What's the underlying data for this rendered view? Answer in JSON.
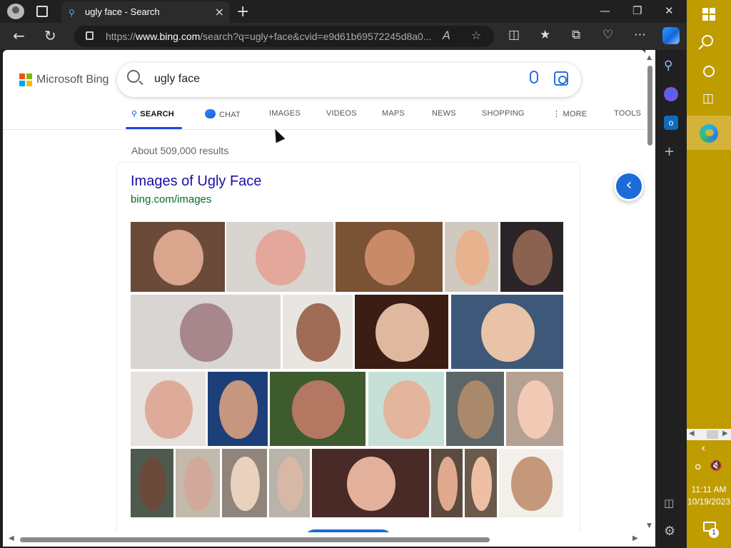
{
  "browser": {
    "tab_title": "ugly face - Search",
    "url_prefix": "https://",
    "url_host": "www.bing.com",
    "url_rest": "/search?q=ugly+face&cvid=e9d61b69572245d8a0...",
    "read_aloud_glyph": "A"
  },
  "bing": {
    "logo_text": "Microsoft Bing",
    "query": "ugly face",
    "scopes": [
      {
        "label": "SEARCH"
      },
      {
        "label": "CHAT"
      },
      {
        "label": "IMAGES"
      },
      {
        "label": "VIDEOS"
      },
      {
        "label": "MAPS"
      },
      {
        "label": "NEWS"
      },
      {
        "label": "SHOPPING"
      },
      {
        "label": "MORE"
      },
      {
        "label": "TOOLS"
      }
    ],
    "result_count": "About 509,000 results",
    "images_card": {
      "title": "Images of Ugly Face",
      "source": "bing.com/images"
    }
  },
  "taskbar": {
    "time": "11:11 AM",
    "date": "10/19/2023",
    "notification_count": "1"
  },
  "colors": {
    "accent": "#174ae4",
    "link": "#1a0dab",
    "source_green": "#006d21",
    "taskbar": "#bf9c00"
  }
}
